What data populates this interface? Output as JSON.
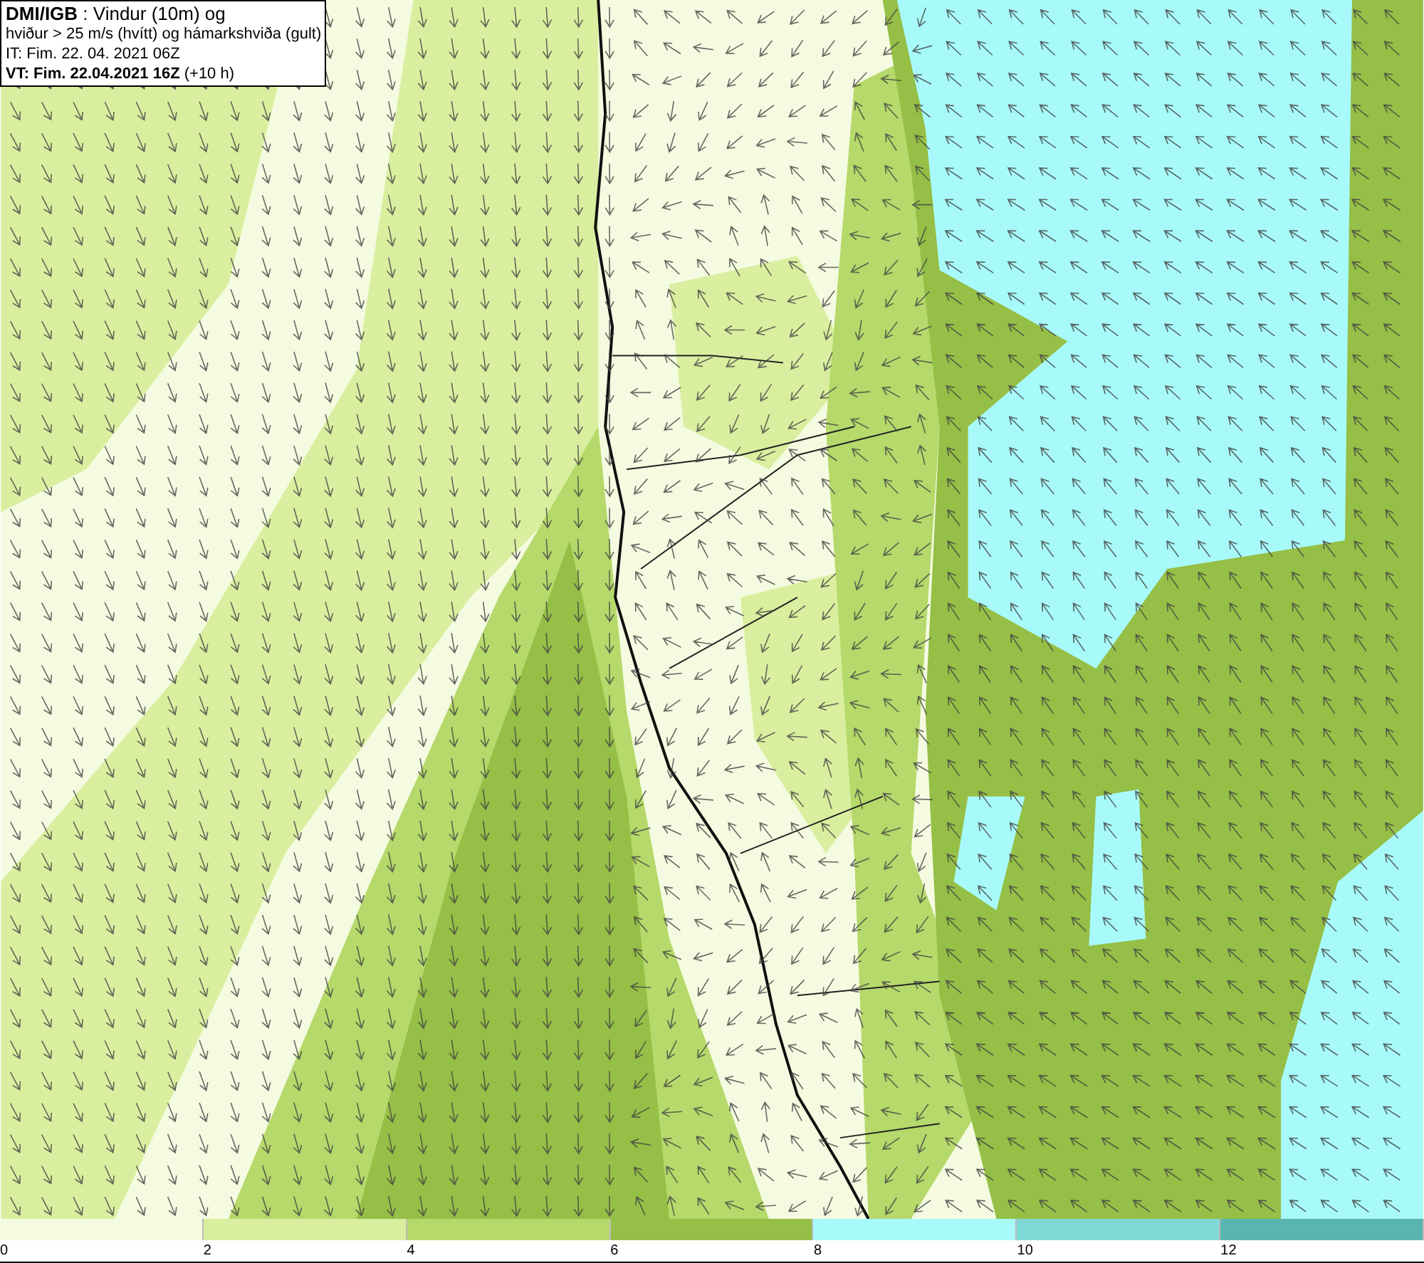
{
  "info_box": {
    "lines": [
      "**DMI/IGB** : Vindur (10m) og",
      "hviður > 25 m/s (hvítt) og hámarkshviða (gult)",
      "IT: Fim. 22. 04. 2021 06Z",
      "**VT: Fim. 22.04.2021 16Z** (+10 h)"
    ]
  },
  "legend": [
    {
      "label": "0",
      "color": "#f5fbe0"
    },
    {
      "label": "2",
      "color": "#d9ef9f"
    },
    {
      "label": "4",
      "color": "#b5d96a"
    },
    {
      "label": "6",
      "color": "#95bf46"
    },
    {
      "label": "8",
      "color": "#a8fafa"
    },
    {
      "label": "10",
      "color": "#7fd9d6"
    },
    {
      "label": "12",
      "color": "#5ab5b2"
    }
  ]
}
